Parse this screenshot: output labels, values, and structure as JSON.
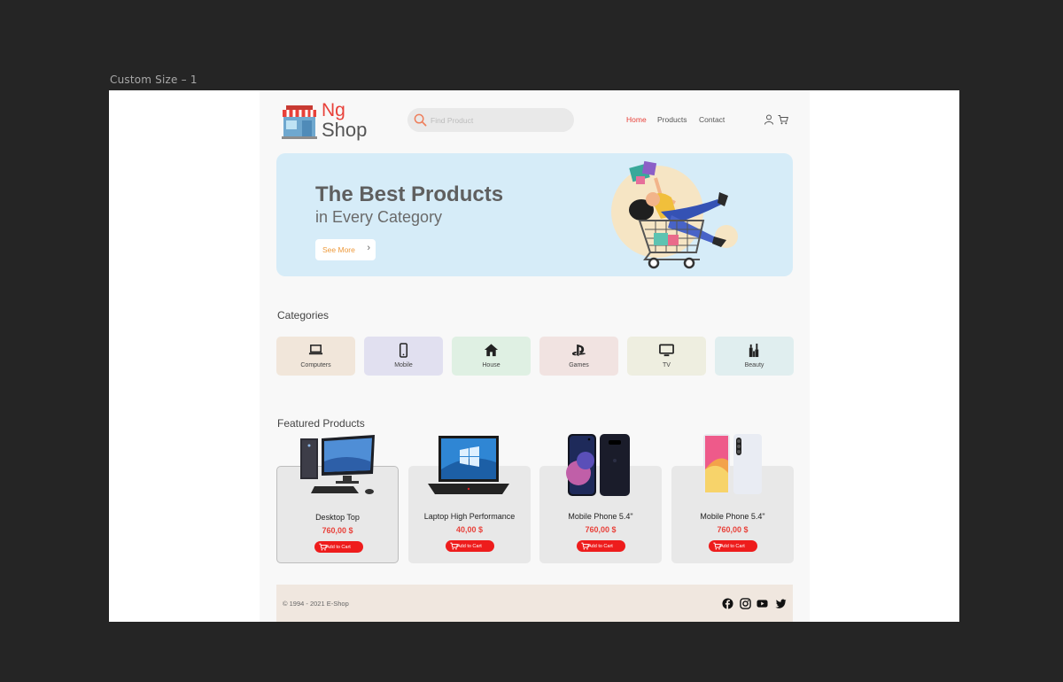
{
  "canvas": {
    "frame_label": "Custom Size – 1"
  },
  "header": {
    "logo_top": "Ng",
    "logo_bottom": "Shop",
    "search": {
      "placeholder": "Find Product",
      "value": ""
    },
    "nav": [
      "Home",
      "Products",
      "Contact"
    ],
    "active_nav": "Home",
    "icons": [
      "user-icon",
      "cart-icon"
    ]
  },
  "hero": {
    "title": "The Best Products",
    "subtitle": "in Every Category",
    "button_label": "See More",
    "image": "shopping-cart-illustration"
  },
  "categories": {
    "title": "Categories",
    "items": [
      {
        "label": "Computers",
        "icon": "laptop-icon",
        "bg": "#f1e6da"
      },
      {
        "label": "Mobile",
        "icon": "mobile-icon",
        "bg": "#e1e0f0"
      },
      {
        "label": "House",
        "icon": "home-icon",
        "bg": "#dff0e3"
      },
      {
        "label": "Games",
        "icon": "playstation-icon",
        "bg": "#f1e3e1"
      },
      {
        "label": "TV",
        "icon": "tv-icon",
        "bg": "#eeeee0"
      },
      {
        "label": "Beauty",
        "icon": "beauty-icon",
        "bg": "#e0eeef"
      }
    ]
  },
  "featured": {
    "title": "Featured Products",
    "button_label": "Add to Cart",
    "products": [
      {
        "name": "Desktop Top",
        "price": "760,00 $",
        "image": "desktop-computer"
      },
      {
        "name": "Laptop High Performance",
        "price": "40,00 $",
        "image": "laptop"
      },
      {
        "name": "Mobile Phone 5.4\"",
        "price": "760,00 $",
        "image": "phone-dark"
      },
      {
        "name": "Mobile Phone 5.4\"",
        "price": "760,00 $",
        "image": "phone-light"
      }
    ]
  },
  "footer": {
    "copyright": "© 1994 - 2021 E-Shop",
    "social": [
      "facebook-icon",
      "instagram-icon",
      "youtube-icon",
      "twitter-icon"
    ]
  },
  "colors": {
    "accent": "#e8413a",
    "button": "#ee1c1c",
    "hero_bg": "#d6ecf8",
    "footer_bg": "#f0e7df",
    "see_more_text": "#ee9a3c"
  }
}
